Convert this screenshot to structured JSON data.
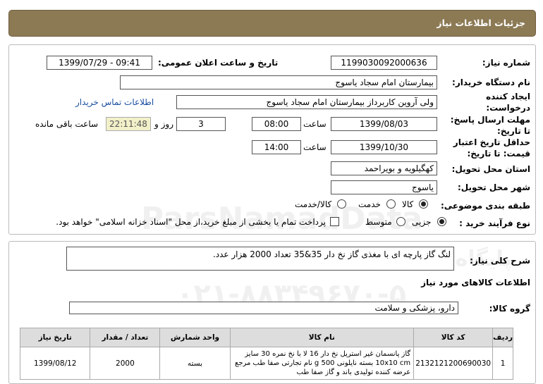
{
  "header": {
    "title": "جزئیات اطلاعات نیاز"
  },
  "form": {
    "need_number_label": "شماره نیاز:",
    "need_number": "1199030092000636",
    "announce_label": "تاریخ و ساعت اعلان عمومی:",
    "announce_value": "1399/07/29 - 09:41",
    "buyer_org_label": "نام دستگاه خریدار:",
    "buyer_org": "بیمارستان امام سجاد یاسوج",
    "creator_label_1": "ایجاد کننده",
    "creator_label_2": "درخواست:",
    "creator": "ولی آروین کاربرداز بیمارستان امام سجاد یاسوج",
    "contact_link": "اطلاعات تماس خریدار",
    "reply_deadline_label_1": "مهلت ارسال پاسخ:",
    "reply_deadline_label_2": "تا تاریخ:",
    "reply_date": "1399/08/03",
    "time_label": "ساعت",
    "reply_time": "08:00",
    "days_value": "3",
    "days_label": "روز و",
    "remaining_time": "22:11:48",
    "remaining_label": "ساعت باقی مانده",
    "validity_label_1": "حداقل تاریخ اعتبار",
    "validity_label_2": "قیمت: تا تاریخ:",
    "validity_date": "1399/10/30",
    "validity_time_label": "ساعت",
    "validity_time": "14:00",
    "province_label": "استان محل تحویل:",
    "province": "کهگیلویه و بویراحمد",
    "city_label": "شهر محل تحویل:",
    "city": "یاسوج",
    "category_label": "طبقه بندی موضوعی:",
    "category_options": [
      "کالا",
      "خدمت",
      "کالا/خدمت"
    ],
    "category_selected": "کالا",
    "process_label": "نوع فرآیند خرید :",
    "process_options": [
      "جزیی",
      "متوسط"
    ],
    "process_selected": "جزیی",
    "treasury_note": "پرداخت تمام یا بخشی از مبلغ خرید،از محل \"اسناد خزانه اسلامی\" خواهد بود."
  },
  "description": {
    "label": "شرح کلی نیاز:",
    "text": "لنگ گاز پارچه ای با مغذی گاز نخ دار 35&35 تعداد 2000 هزار عدد."
  },
  "goods_section": {
    "title": "اطلاعات کالاهای مورد نیاز",
    "group_label": "گروه کالا:",
    "group_value": "دارو، پزشکی و سلامت"
  },
  "table": {
    "headers": [
      "ردیف",
      "کد کالا",
      "نام کالا",
      "واحد شمارش",
      "تعداد / مقدار",
      "تاریخ نیاز"
    ],
    "rows": [
      {
        "index": "1",
        "code": "2132121200690030",
        "name_lines": [
          "گاز پانسمان غیر استریل نخ دار 16 لا با نخ نمره 30 سایز",
          "10x10 cm بسته نایلونی 500 g نام تجارتی صفا طب مرجع",
          "عرضه کننده تولیدی باند و گاز صفا طب"
        ],
        "unit": "بسته",
        "qty": "2000",
        "date": "1399/08/12"
      }
    ]
  },
  "watermark": {
    "line1": "ParsNamadData",
    "line2": "پایگاه اطلاع رسانی مناقصه و مزایده",
    "line3": "۰۲۱-۸۸۳۴۹۶۷۰-۵"
  }
}
